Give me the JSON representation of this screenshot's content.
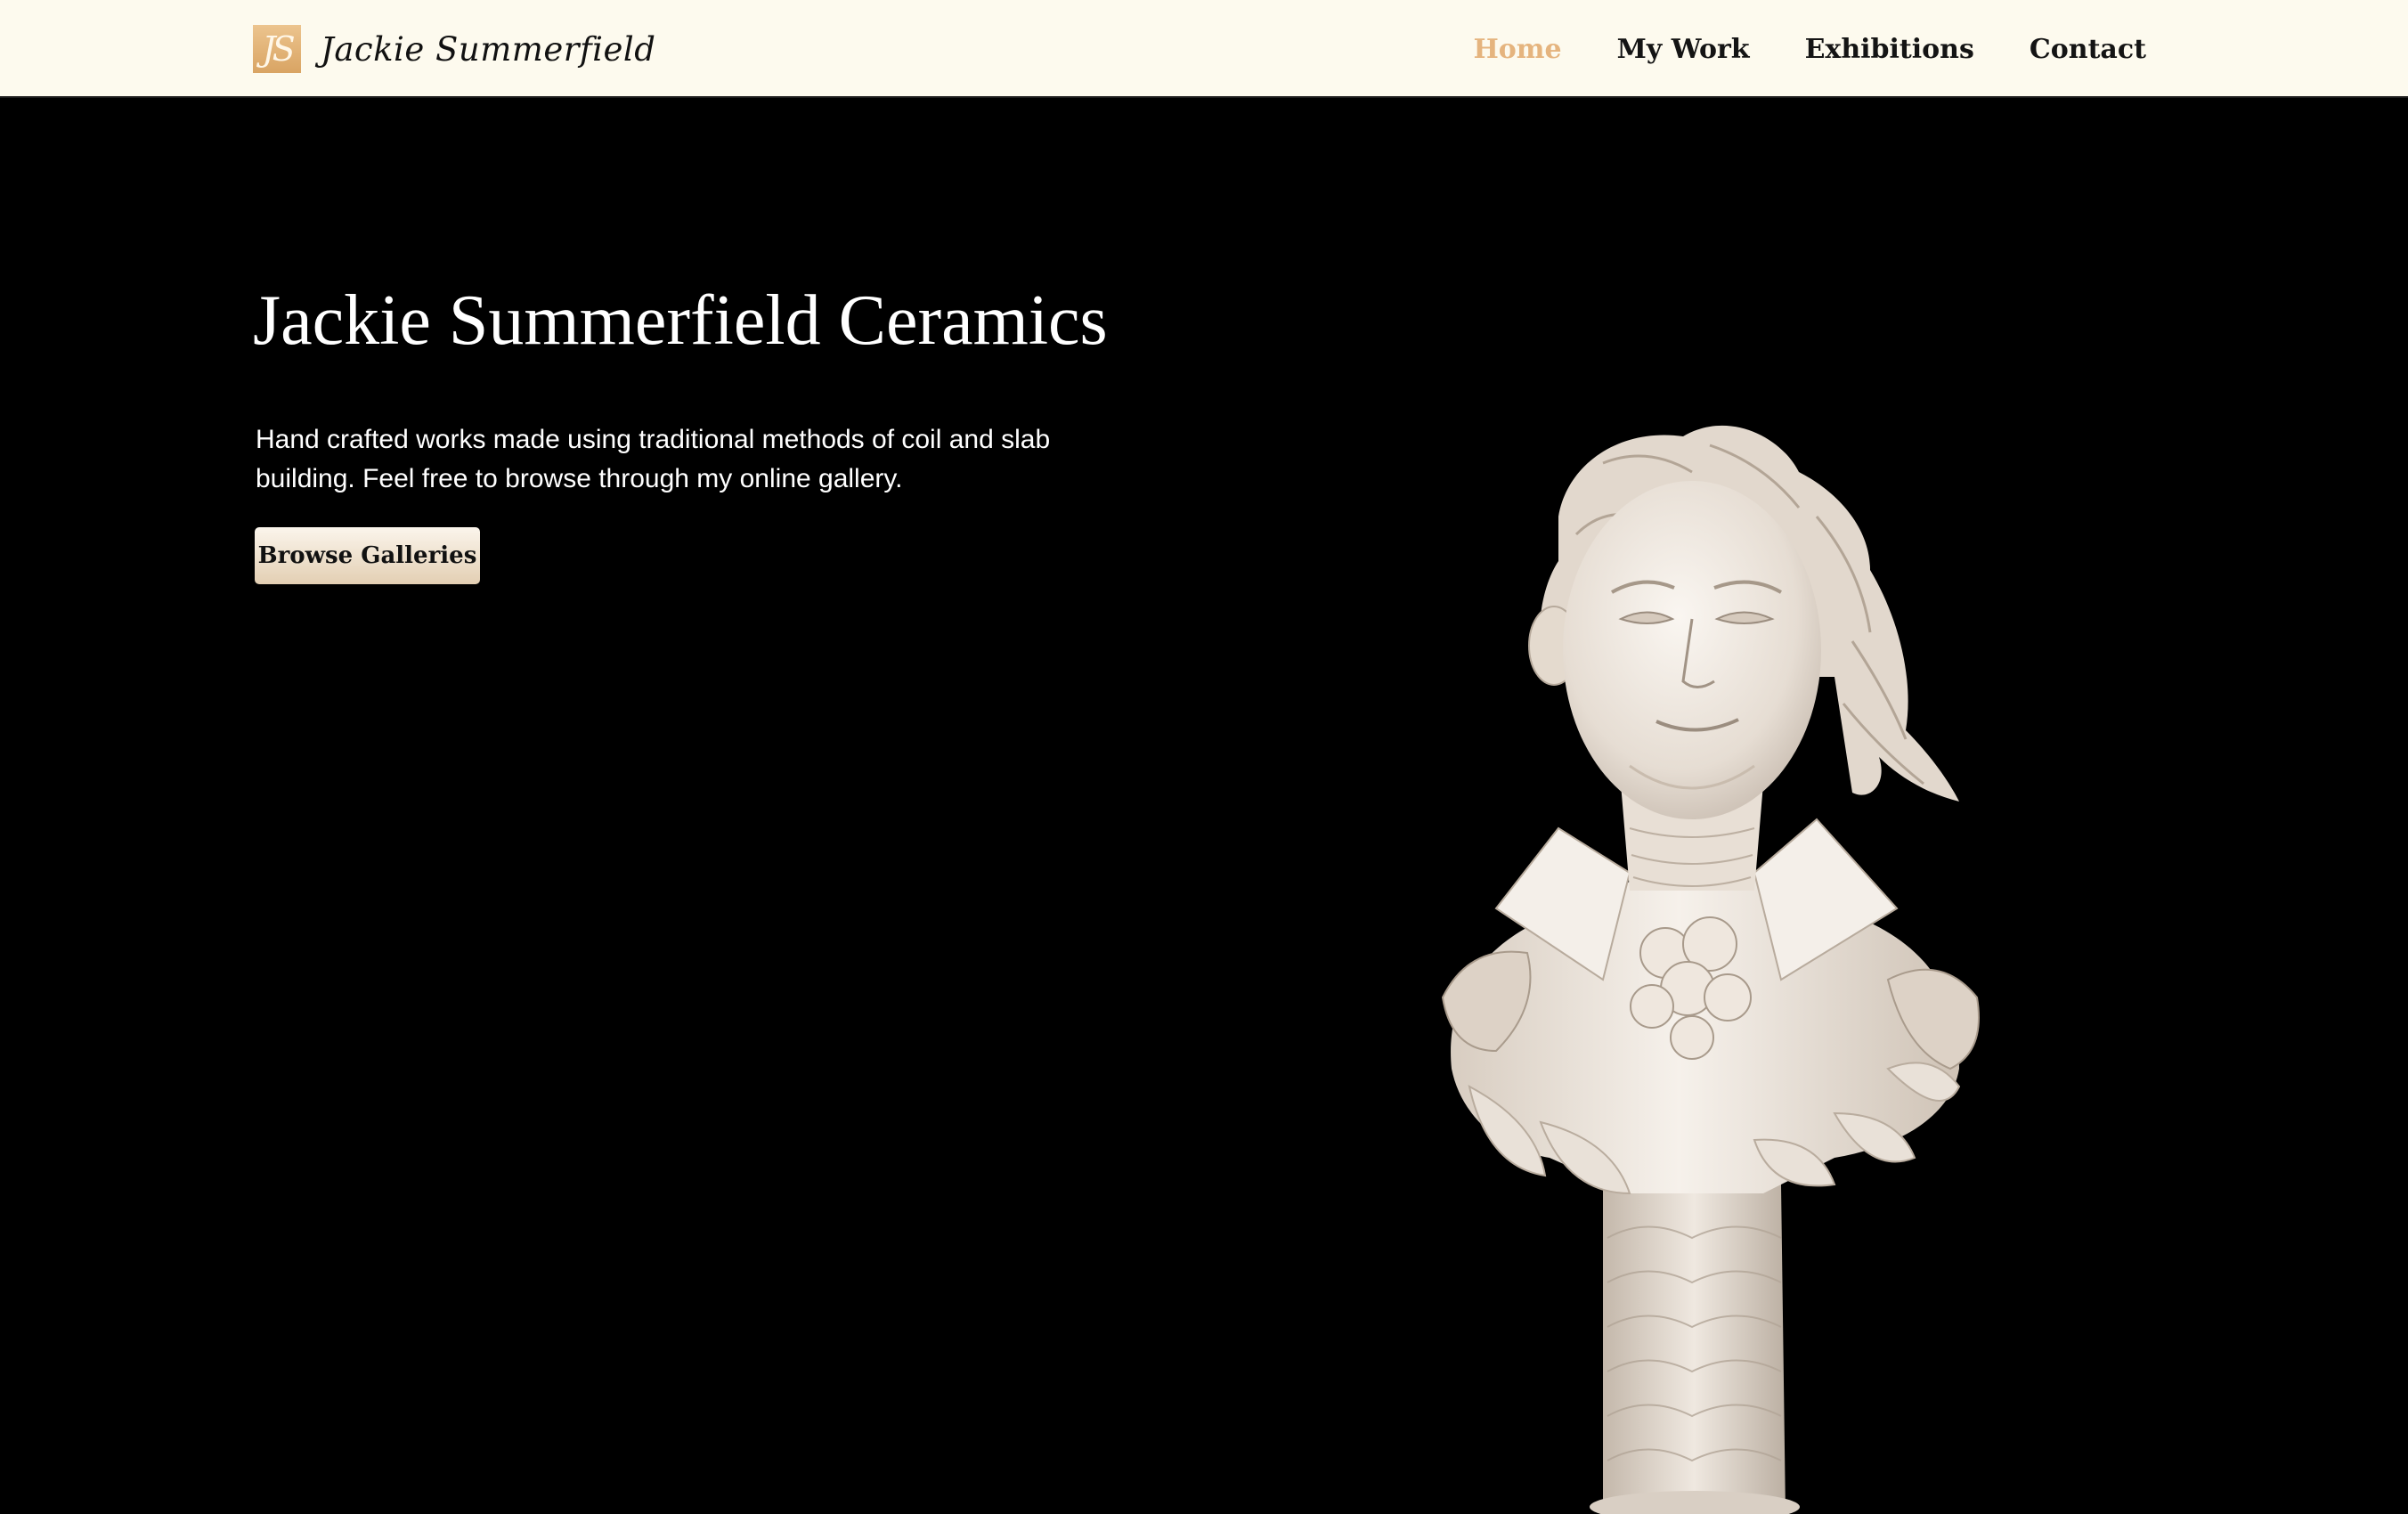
{
  "header": {
    "logo_text": "JS",
    "brand_name": "Jackie Summerfield",
    "nav": [
      {
        "label": "Home",
        "active": true
      },
      {
        "label": "My Work",
        "active": false
      },
      {
        "label": "Exhibitions",
        "active": false
      },
      {
        "label": "Contact",
        "active": false
      }
    ]
  },
  "hero": {
    "title": "Jackie Summerfield Ceramics",
    "description": "Hand crafted works made using traditional methods of coil and slab building. Feel free to browse through my online gallery.",
    "cta_label": "Browse Galleries"
  },
  "colors": {
    "nav_background": "#fdfaee",
    "accent": "#e5b47e",
    "hero_background": "#000000"
  }
}
